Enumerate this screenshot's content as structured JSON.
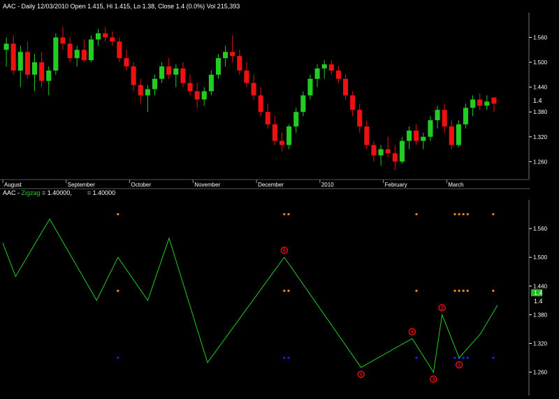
{
  "colors": {
    "background": "#000000",
    "up": "#22cc22",
    "down": "#ee1111",
    "zigzag": "#22cc22",
    "marker_orange": "#ff8c1a",
    "marker_blue": "#2222ff",
    "badge_bg": "#22bb22",
    "axis_text": "#ffffff"
  },
  "chart_data": [
    {
      "type": "candlestick",
      "title": "AAC - Daily 12/03/2010 Open 1.415, Hi 1.415, Lo 1.38, Close 1.4 (0.0%) Vol 215,393",
      "ylim": [
        1.22,
        1.62
      ],
      "yticks": [
        "1.560",
        "1.500",
        "1.440",
        "1.380",
        "1.320",
        "1.260"
      ],
      "price_label": "1.4",
      "months": [
        "August",
        "September",
        "October",
        "November",
        "December",
        "2010",
        "February",
        "March"
      ],
      "candles": [
        {
          "o": 1.53,
          "h": 1.56,
          "l": 1.49,
          "c": 1.545
        },
        {
          "o": 1.545,
          "h": 1.565,
          "l": 1.47,
          "c": 1.48
        },
        {
          "o": 1.48,
          "h": 1.54,
          "l": 1.44,
          "c": 1.525
        },
        {
          "o": 1.525,
          "h": 1.55,
          "l": 1.46,
          "c": 1.47
        },
        {
          "o": 1.47,
          "h": 1.52,
          "l": 1.43,
          "c": 1.5
        },
        {
          "o": 1.5,
          "h": 1.525,
          "l": 1.44,
          "c": 1.455
        },
        {
          "o": 1.455,
          "h": 1.49,
          "l": 1.42,
          "c": 1.48
        },
        {
          "o": 1.48,
          "h": 1.57,
          "l": 1.47,
          "c": 1.56
        },
        {
          "o": 1.56,
          "h": 1.585,
          "l": 1.53,
          "c": 1.545
        },
        {
          "o": 1.545,
          "h": 1.56,
          "l": 1.5,
          "c": 1.51
        },
        {
          "o": 1.51,
          "h": 1.54,
          "l": 1.49,
          "c": 1.53
        },
        {
          "o": 1.53,
          "h": 1.555,
          "l": 1.5,
          "c": 1.505
        },
        {
          "o": 1.505,
          "h": 1.565,
          "l": 1.5,
          "c": 1.555
        },
        {
          "o": 1.555,
          "h": 1.58,
          "l": 1.54,
          "c": 1.57
        },
        {
          "o": 1.57,
          "h": 1.585,
          "l": 1.55,
          "c": 1.56
        },
        {
          "o": 1.56,
          "h": 1.575,
          "l": 1.54,
          "c": 1.55
        },
        {
          "o": 1.55,
          "h": 1.56,
          "l": 1.5,
          "c": 1.51
        },
        {
          "o": 1.51,
          "h": 1.53,
          "l": 1.48,
          "c": 1.49
        },
        {
          "o": 1.49,
          "h": 1.5,
          "l": 1.43,
          "c": 1.445
        },
        {
          "o": 1.445,
          "h": 1.46,
          "l": 1.4,
          "c": 1.42
        },
        {
          "o": 1.42,
          "h": 1.445,
          "l": 1.38,
          "c": 1.435
        },
        {
          "o": 1.435,
          "h": 1.47,
          "l": 1.42,
          "c": 1.46
        },
        {
          "o": 1.46,
          "h": 1.5,
          "l": 1.45,
          "c": 1.49
        },
        {
          "o": 1.49,
          "h": 1.51,
          "l": 1.46,
          "c": 1.47
        },
        {
          "o": 1.47,
          "h": 1.495,
          "l": 1.44,
          "c": 1.485
        },
        {
          "o": 1.485,
          "h": 1.5,
          "l": 1.44,
          "c": 1.45
        },
        {
          "o": 1.45,
          "h": 1.47,
          "l": 1.42,
          "c": 1.43
        },
        {
          "o": 1.43,
          "h": 1.45,
          "l": 1.39,
          "c": 1.41
        },
        {
          "o": 1.41,
          "h": 1.44,
          "l": 1.395,
          "c": 1.43
        },
        {
          "o": 1.43,
          "h": 1.48,
          "l": 1.42,
          "c": 1.47
        },
        {
          "o": 1.47,
          "h": 1.52,
          "l": 1.46,
          "c": 1.51
        },
        {
          "o": 1.51,
          "h": 1.54,
          "l": 1.49,
          "c": 1.525
        },
        {
          "o": 1.525,
          "h": 1.565,
          "l": 1.5,
          "c": 1.515
        },
        {
          "o": 1.515,
          "h": 1.53,
          "l": 1.47,
          "c": 1.48
        },
        {
          "o": 1.48,
          "h": 1.5,
          "l": 1.44,
          "c": 1.45
        },
        {
          "o": 1.45,
          "h": 1.47,
          "l": 1.41,
          "c": 1.42
        },
        {
          "o": 1.42,
          "h": 1.44,
          "l": 1.37,
          "c": 1.38
        },
        {
          "o": 1.38,
          "h": 1.4,
          "l": 1.34,
          "c": 1.35
        },
        {
          "o": 1.35,
          "h": 1.37,
          "l": 1.3,
          "c": 1.31
        },
        {
          "o": 1.31,
          "h": 1.33,
          "l": 1.285,
          "c": 1.3
        },
        {
          "o": 1.3,
          "h": 1.35,
          "l": 1.29,
          "c": 1.345
        },
        {
          "o": 1.345,
          "h": 1.39,
          "l": 1.33,
          "c": 1.38
        },
        {
          "o": 1.38,
          "h": 1.43,
          "l": 1.37,
          "c": 1.42
        },
        {
          "o": 1.42,
          "h": 1.47,
          "l": 1.41,
          "c": 1.46
        },
        {
          "o": 1.46,
          "h": 1.495,
          "l": 1.44,
          "c": 1.485
        },
        {
          "o": 1.485,
          "h": 1.505,
          "l": 1.46,
          "c": 1.495
        },
        {
          "o": 1.495,
          "h": 1.505,
          "l": 1.47,
          "c": 1.48
        },
        {
          "o": 1.48,
          "h": 1.49,
          "l": 1.45,
          "c": 1.46
        },
        {
          "o": 1.46,
          "h": 1.47,
          "l": 1.41,
          "c": 1.42
        },
        {
          "o": 1.42,
          "h": 1.43,
          "l": 1.37,
          "c": 1.385
        },
        {
          "o": 1.385,
          "h": 1.4,
          "l": 1.33,
          "c": 1.345
        },
        {
          "o": 1.345,
          "h": 1.36,
          "l": 1.29,
          "c": 1.3
        },
        {
          "o": 1.3,
          "h": 1.31,
          "l": 1.26,
          "c": 1.275
        },
        {
          "o": 1.275,
          "h": 1.3,
          "l": 1.25,
          "c": 1.29
        },
        {
          "o": 1.29,
          "h": 1.32,
          "l": 1.27,
          "c": 1.28
        },
        {
          "o": 1.28,
          "h": 1.3,
          "l": 1.24,
          "c": 1.26
        },
        {
          "o": 1.26,
          "h": 1.32,
          "l": 1.255,
          "c": 1.31
        },
        {
          "o": 1.31,
          "h": 1.345,
          "l": 1.29,
          "c": 1.335
        },
        {
          "o": 1.335,
          "h": 1.35,
          "l": 1.3,
          "c": 1.31
        },
        {
          "o": 1.31,
          "h": 1.33,
          "l": 1.29,
          "c": 1.32
        },
        {
          "o": 1.32,
          "h": 1.37,
          "l": 1.31,
          "c": 1.36
        },
        {
          "o": 1.36,
          "h": 1.395,
          "l": 1.34,
          "c": 1.385
        },
        {
          "o": 1.385,
          "h": 1.4,
          "l": 1.33,
          "c": 1.345
        },
        {
          "o": 1.345,
          "h": 1.36,
          "l": 1.29,
          "c": 1.3
        },
        {
          "o": 1.3,
          "h": 1.36,
          "l": 1.295,
          "c": 1.35
        },
        {
          "o": 1.35,
          "h": 1.4,
          "l": 1.34,
          "c": 1.39
        },
        {
          "o": 1.39,
          "h": 1.42,
          "l": 1.37,
          "c": 1.41
        },
        {
          "o": 1.41,
          "h": 1.425,
          "l": 1.385,
          "c": 1.395
        },
        {
          "o": 1.395,
          "h": 1.42,
          "l": 1.385,
          "c": 1.405
        },
        {
          "o": 1.415,
          "h": 1.415,
          "l": 1.38,
          "c": 1.4
        }
      ]
    },
    {
      "type": "line",
      "title": "AAC - Zigzag = 1.40000,       = 1.40000",
      "label_prefix": "AAC - ",
      "label_name": "Zigzag",
      "label_value": " = 1.40000,",
      "label_value2": "= 1.40000",
      "ylim": [
        1.22,
        1.62
      ],
      "yticks": [
        "1.560",
        "1.500",
        "1.440",
        "1.380",
        "1.320",
        "1.260"
      ],
      "price_badge": "1.4",
      "price_label": "1.4",
      "series": [
        {
          "x": [
            0,
            3,
            11,
            22,
            27,
            34,
            39,
            48,
            66,
            84,
            96,
            101,
            103,
            107,
            112,
            116
          ],
          "y": [
            1.53,
            1.46,
            1.58,
            1.41,
            1.5,
            1.41,
            1.54,
            1.28,
            1.5,
            1.27,
            1.33,
            1.26,
            1.38,
            1.29,
            1.34,
            1.4
          ]
        }
      ],
      "xmax": 116,
      "annotations": [
        {
          "x": 66,
          "y": 1.5,
          "label": "6",
          "pos": "above"
        },
        {
          "x": 84,
          "y": 1.27,
          "label": "5",
          "pos": "below"
        },
        {
          "x": 96,
          "y": 1.33,
          "label": "4",
          "pos": "above"
        },
        {
          "x": 101,
          "y": 1.26,
          "label": "3",
          "pos": "below"
        },
        {
          "x": 103,
          "y": 1.38,
          "label": "2",
          "pos": "above"
        },
        {
          "x": 107,
          "y": 1.29,
          "label": "1",
          "pos": "below"
        }
      ],
      "marker_x": [
        27,
        66,
        67,
        97,
        106,
        107,
        108,
        109,
        115
      ],
      "marker_levels": [
        {
          "y": 1.59,
          "color": "orange"
        },
        {
          "y": 1.43,
          "color": "orange"
        },
        {
          "y": 1.29,
          "color": "blue"
        }
      ]
    }
  ]
}
